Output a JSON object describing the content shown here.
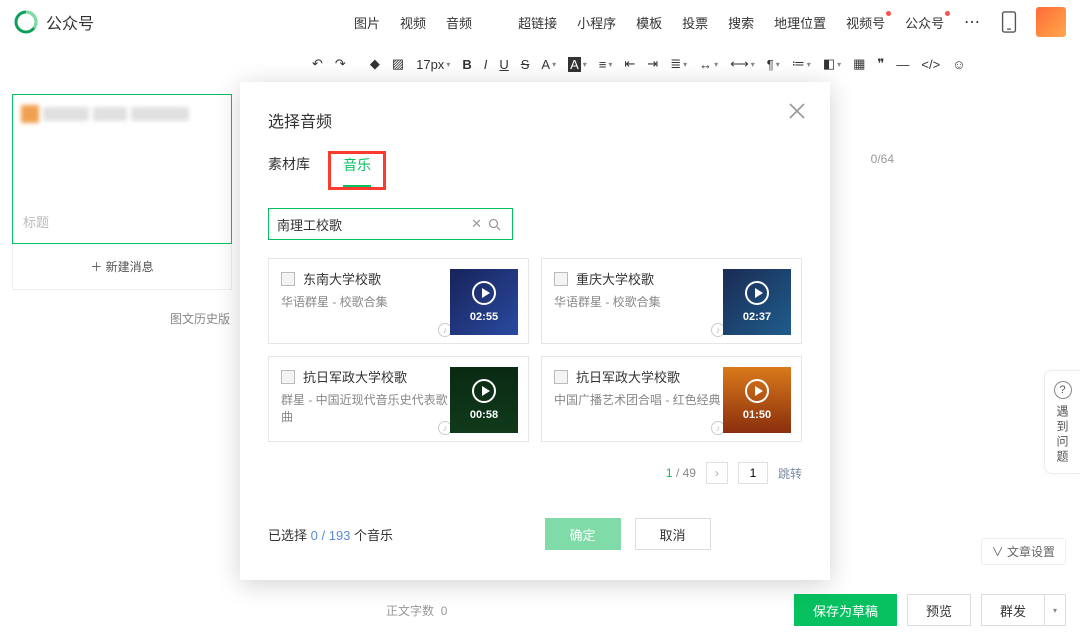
{
  "header": {
    "app_name": "公众号",
    "menu": [
      "图片",
      "视频",
      "音频",
      "超链接",
      "小程序",
      "模板",
      "投票",
      "搜索",
      "地理位置",
      "视频号",
      "公众号"
    ],
    "red_dot_indices": [
      9,
      10
    ]
  },
  "toolbar": {
    "font_size": "17px"
  },
  "left": {
    "title_placeholder": "标题",
    "new_message": "新建消息",
    "history": "图文历史版"
  },
  "right": {
    "char_counter": "0/64",
    "article_settings_prefix": "∨",
    "article_settings": "文章设置"
  },
  "help": {
    "label": "遇到问题"
  },
  "footer": {
    "wordcount_label": "正文字数",
    "wordcount_value": "0",
    "save_draft": "保存为草稿",
    "preview": "预览",
    "publish": "群发"
  },
  "modal": {
    "title": "选择音频",
    "tabs": {
      "library": "素材库",
      "music": "音乐"
    },
    "search_value": "南理工校歌",
    "results": [
      {
        "title": "东南大学校歌",
        "subtitle": "华语群星 - 校歌合集",
        "duration": "02:55",
        "thumb": "a"
      },
      {
        "title": "重庆大学校歌",
        "subtitle": "华语群星 - 校歌合集",
        "duration": "02:37",
        "thumb": "b"
      },
      {
        "title": "抗日军政大学校歌",
        "subtitle": "群星 - 中国近现代音乐史代表歌曲",
        "duration": "00:58",
        "thumb": "c"
      },
      {
        "title": "抗日军政大学校歌",
        "subtitle": "中国广播艺术团合唱 - 红色经典",
        "duration": "01:50",
        "thumb": "d"
      }
    ],
    "pager": {
      "current": "1",
      "total": "49",
      "jump_value": "1",
      "jump_label": "跳转"
    },
    "selected_prefix": "已选择",
    "selected_count": "0",
    "selected_total": "193",
    "selected_unit": "个音乐",
    "ok": "确定",
    "cancel": "取消"
  }
}
